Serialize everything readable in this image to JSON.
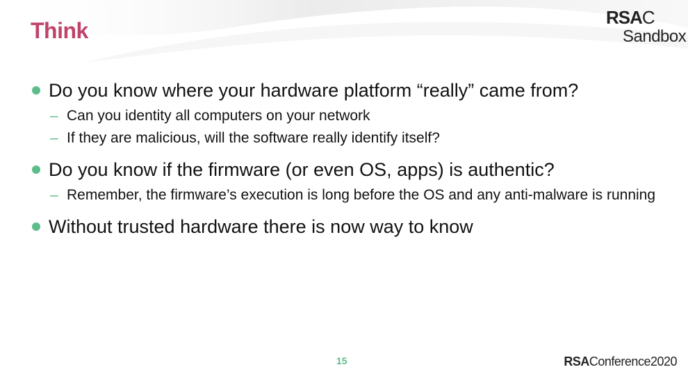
{
  "slide": {
    "title": "Think",
    "logo_top": {
      "brand": "RSA",
      "brand_suffix": "C",
      "sub": "Sandbox"
    },
    "bullets": [
      {
        "text": "Do you know where your hardware platform “really” came from?",
        "subitems": [
          "Can you identity all computers on your network",
          "If they are malicious, will the software really identify itself?"
        ]
      },
      {
        "text": "Do you know if the firmware (or even OS, apps) is authentic?",
        "subitems": [
          "Remember, the firmware’s execution is long before the OS and any anti-malware is running"
        ]
      },
      {
        "text": "Without trusted hardware there is now way to know",
        "subitems": []
      }
    ],
    "dash_glyph": "–",
    "page_number": "15",
    "logo_bottom": {
      "brand": "RSA",
      "conference": "Conference2020"
    },
    "colors": {
      "title": "#c0436a",
      "accent": "#5dbd8a",
      "text": "#111111"
    }
  }
}
